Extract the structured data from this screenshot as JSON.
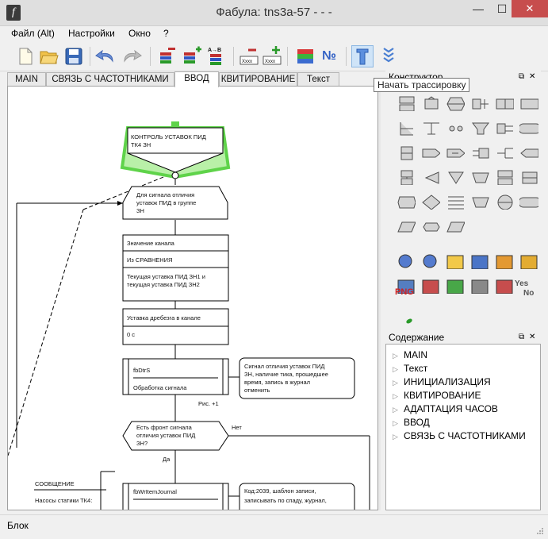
{
  "window": {
    "title": "Фабула: tns3a-57 - - -",
    "min_glyph": "—",
    "max_glyph": "☐",
    "close_glyph": "✕"
  },
  "menu": [
    "Файл (Alt)",
    "Настройки",
    "Окно",
    "?"
  ],
  "toolbar_icons": [
    "new-file-icon",
    "open-folder-icon",
    "save-icon",
    "undo-icon",
    "redo-icon",
    "stack-remove-icon",
    "stack-add-icon",
    "stack-ab-icon",
    "block-remove-icon",
    "block-add-icon",
    "color-palette-icon",
    "numbering-icon",
    "trace-icon",
    "collapse-icon"
  ],
  "toolbar_text": {
    "ab": "A→B",
    "num": "№",
    "xxx": "Xxxx"
  },
  "tabs": [
    {
      "label": "MAIN",
      "selected": false
    },
    {
      "label": "СВЯЗЬ С ЧАСТОТНИКАМИ",
      "selected": false
    },
    {
      "label": "ВВОД",
      "selected": true
    },
    {
      "label": "КВИТИРОВАНИЕ",
      "selected": false
    },
    {
      "label": "Текст",
      "selected": false
    }
  ],
  "tooltip": "Начать трассировку",
  "constructor_panel": {
    "title": "Конструктор",
    "extra_labels": {
      "png": "PNG",
      "yes": "Yes",
      "no": "No"
    }
  },
  "content_panel": {
    "title": "Содержание",
    "items": [
      "MAIN",
      "Текст",
      "ИНИЦИАЛИЗАЦИЯ",
      "КВИТИРОВАНИЕ",
      "АДАПТАЦИЯ ЧАСОВ",
      "ВВОД",
      "СВЯЗЬ С ЧАСТОТНИКАМИ"
    ]
  },
  "flowchart": {
    "start_block": [
      "КОНТРОЛЬ УСТАВОК ПИД",
      "ТК4 ЗН"
    ],
    "loop_block": [
      "Для сигнала отличия",
      "уставок ПИД в группе",
      "ЗН"
    ],
    "value_block": {
      "row1": "Значение канала",
      "row2": "Из СРАВНЕНИЯ",
      "row3": [
        "Текущая уставка ПИД ЗН1 и",
        "текущая уставка ПИД ЗН2"
      ]
    },
    "debounce_block": {
      "row1": "Уставка дребезга в канале",
      "row2": "0 с"
    },
    "fbdtrs_block": {
      "row1": "fbDtrS",
      "row2": "Обработка сигнала"
    },
    "comment1": [
      "Сигнал отличия уставок ПИД",
      "ЗН, наличие тика, прошедшее",
      "время, запись в журнал",
      "отменить"
    ],
    "figure_label": "Рис. +1",
    "decision_block": [
      "Есть фронт сигнала",
      "отличия уставок ПИД",
      "ЗН?"
    ],
    "decision_no": "Нет",
    "decision_yes": "Да",
    "message_block": {
      "title": "СООБЩЕНИЕ",
      "line1": "Насосы статики ТК4:"
    },
    "journal_block": {
      "row1": "fbWrItemJournal"
    },
    "comment2": [
      "Код:2039, шаблон записи,",
      "записывать по спаду, журнал,"
    ]
  },
  "status": "Блок",
  "colors": {
    "accent_green": "#5fd34a",
    "close_red": "#c74d4d",
    "selection_blue": "#cfe4f8"
  }
}
